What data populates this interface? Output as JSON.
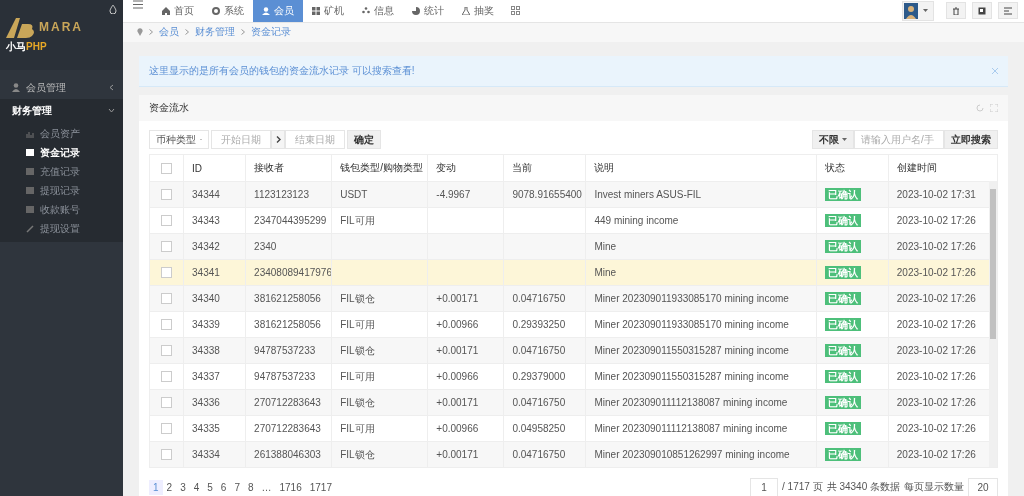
{
  "sidebar": {
    "logo_text": "MARA",
    "brand": {
      "prefix": "小马",
      "suffix": "PHP"
    },
    "menu": [
      {
        "label": "会员管理",
        "expanded": false
      },
      {
        "label": "财务管理",
        "expanded": true,
        "children": [
          {
            "label": "会员资产",
            "selected": false
          },
          {
            "label": "资金记录",
            "selected": true
          },
          {
            "label": "充值记录",
            "selected": false
          },
          {
            "label": "提现记录",
            "selected": false
          },
          {
            "label": "收款账号",
            "selected": false
          },
          {
            "label": "提现设置",
            "selected": false
          }
        ]
      }
    ]
  },
  "top_nav": [
    {
      "label": "首页",
      "selected": false
    },
    {
      "label": "系统",
      "selected": false
    },
    {
      "label": "会员",
      "selected": true
    },
    {
      "label": "矿机",
      "selected": false
    },
    {
      "label": "信息",
      "selected": false
    },
    {
      "label": "统计",
      "selected": false
    },
    {
      "label": "抽奖",
      "selected": false
    }
  ],
  "breadcrumb": [
    "会员",
    "财务管理",
    "资金记录"
  ],
  "alert": "这里显示的是所有会员的钱包的资金流水记录 可以搜索查看!",
  "panel": {
    "title": "资金流水",
    "filters": {
      "coin_select": "币种类型",
      "start_placeholder": "开始日期",
      "end_placeholder": "结束日期",
      "confirm": "确定",
      "scope": "不限",
      "search_placeholder": "请输入用户名/手",
      "search_button": "立即搜索"
    },
    "table": {
      "header_checked": false,
      "columns": [
        "ID",
        "接收者",
        "钱包类型/购物类型",
        "变动",
        "当前",
        "说明",
        "状态",
        "创建时间"
      ],
      "rows": [
        {
          "checked": false,
          "highlighted": false,
          "id": "34344",
          "receiver": "1123123123",
          "wallet": "USDT",
          "change": "-4.9967",
          "current": "9078.91655400",
          "note": "Invest miners ASUS-FIL",
          "status": "已确认",
          "created": "2023-10-02 17:31"
        },
        {
          "checked": false,
          "highlighted": false,
          "id": "34343",
          "receiver": "2347044395299",
          "wallet": "FIL可用",
          "note": "449 mining income",
          "status": "已确认",
          "created": "2023-10-02 17:26"
        },
        {
          "checked": false,
          "highlighted": false,
          "id": "34342",
          "receiver": "2340",
          "note": "Mine",
          "status": "已确认",
          "created": "2023-10-02 17:26"
        },
        {
          "checked": false,
          "highlighted": true,
          "id": "34341",
          "receiver": "23408089417976",
          "note": "Mine",
          "status": "已确认",
          "created": "2023-10-02 17:26"
        },
        {
          "checked": false,
          "highlighted": false,
          "id": "34340",
          "receiver": "381621258056",
          "wallet": "FIL锁仓",
          "change": "+0.00171",
          "current": "0.04716750",
          "note": "Miner 202309011933085170 mining income",
          "status": "已确认",
          "created": "2023-10-02 17:26"
        },
        {
          "checked": false,
          "highlighted": false,
          "id": "34339",
          "receiver": "381621258056",
          "wallet": "FIL可用",
          "change": "+0.00966",
          "current": "0.29393250",
          "note": "Miner 202309011933085170 mining income",
          "status": "已确认",
          "created": "2023-10-02 17:26"
        },
        {
          "checked": false,
          "highlighted": false,
          "id": "34338",
          "receiver": "94787537233",
          "wallet": "FIL锁仓",
          "change": "+0.00171",
          "current": "0.04716750",
          "note": "Miner 202309011550315287 mining income",
          "status": "已确认",
          "created": "2023-10-02 17:26"
        },
        {
          "checked": false,
          "highlighted": false,
          "id": "34337",
          "receiver": "94787537233",
          "wallet": "FIL可用",
          "change": "+0.00966",
          "current": "0.29379000",
          "note": "Miner 202309011550315287 mining income",
          "status": "已确认",
          "created": "2023-10-02 17:26"
        },
        {
          "checked": false,
          "highlighted": false,
          "id": "34336",
          "receiver": "270712283643",
          "wallet": "FIL锁仓",
          "change": "+0.00171",
          "current": "0.04716750",
          "note": "Miner 202309011112138087 mining income",
          "status": "已确认",
          "created": "2023-10-02 17:26"
        },
        {
          "checked": false,
          "highlighted": false,
          "id": "34335",
          "receiver": "270712283643",
          "wallet": "FIL可用",
          "change": "+0.00966",
          "current": "0.04958250",
          "note": "Miner 202309011112138087 mining income",
          "status": "已确认",
          "created": "2023-10-02 17:26"
        },
        {
          "checked": false,
          "highlighted": false,
          "id": "34334",
          "receiver": "261388046303",
          "wallet": "FIL锁仓",
          "change": "+0.00171",
          "current": "0.04716750",
          "note": "Miner 202309010851262997 mining income",
          "status": "已确认",
          "created": "2023-10-02 17:26"
        }
      ]
    },
    "pagination": {
      "pages": [
        {
          "label": "1",
          "selected": true
        },
        {
          "label": "2",
          "selected": false
        },
        {
          "label": "3",
          "selected": false
        },
        {
          "label": "4",
          "selected": false
        },
        {
          "label": "5",
          "selected": false
        },
        {
          "label": "6",
          "selected": false
        },
        {
          "label": "7",
          "selected": false
        },
        {
          "label": "8",
          "selected": false
        },
        {
          "label": "…",
          "selected": false
        },
        {
          "label": "1716",
          "selected": false
        },
        {
          "label": "1717",
          "selected": false
        }
      ],
      "jump_value": "1",
      "total_pages": "/ 1717 页",
      "total": "共 34340 条数据",
      "per_page_label": "每页显示数量",
      "per_page": "20"
    }
  }
}
